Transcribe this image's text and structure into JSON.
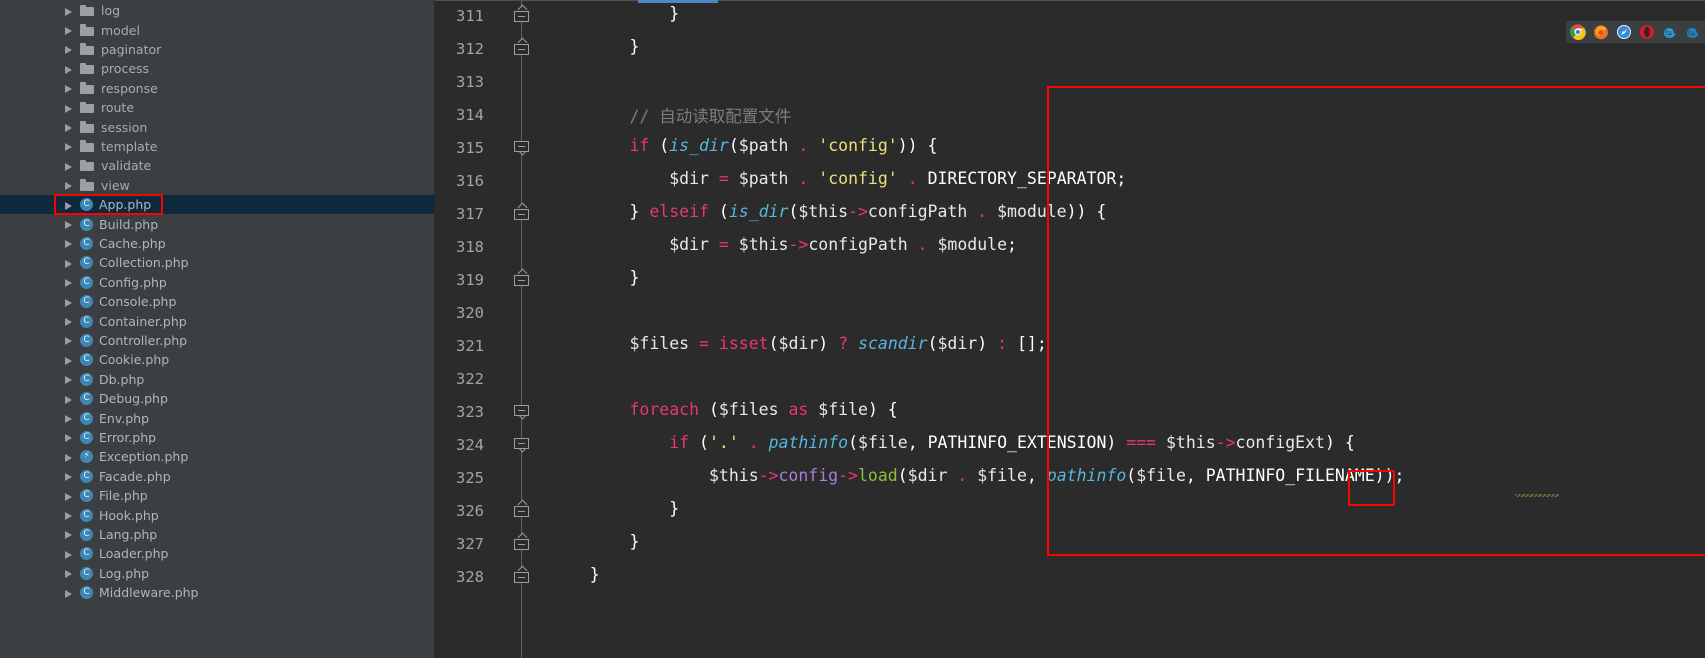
{
  "window": {
    "app": "PhpStorm IDE",
    "theme_bg": "#2b2b2b",
    "sidebar_bg": "#3c3f41",
    "accent": "#4a88c7",
    "highlight_color": "#ff0000"
  },
  "project_tree": {
    "name": "project-file-tree",
    "selected": "App.php",
    "items": [
      {
        "label": "log",
        "type": "folder"
      },
      {
        "label": "model",
        "type": "folder"
      },
      {
        "label": "paginator",
        "type": "folder"
      },
      {
        "label": "process",
        "type": "folder"
      },
      {
        "label": "response",
        "type": "folder"
      },
      {
        "label": "route",
        "type": "folder"
      },
      {
        "label": "session",
        "type": "folder"
      },
      {
        "label": "template",
        "type": "folder"
      },
      {
        "label": "validate",
        "type": "folder"
      },
      {
        "label": "view",
        "type": "folder"
      },
      {
        "label": "App.php",
        "type": "php-class",
        "icon_glyph": "C",
        "selected": true
      },
      {
        "label": "Build.php",
        "type": "php-class",
        "icon_glyph": "C"
      },
      {
        "label": "Cache.php",
        "type": "php-class",
        "icon_glyph": "C"
      },
      {
        "label": "Collection.php",
        "type": "php-class",
        "icon_glyph": "C"
      },
      {
        "label": "Config.php",
        "type": "php-class",
        "icon_glyph": "C"
      },
      {
        "label": "Console.php",
        "type": "php-class",
        "icon_glyph": "C"
      },
      {
        "label": "Container.php",
        "type": "php-class",
        "icon_glyph": "C"
      },
      {
        "label": "Controller.php",
        "type": "php-class",
        "icon_glyph": "C"
      },
      {
        "label": "Cookie.php",
        "type": "php-class",
        "icon_glyph": "C"
      },
      {
        "label": "Db.php",
        "type": "php-class",
        "icon_glyph": "C"
      },
      {
        "label": "Debug.php",
        "type": "php-class",
        "icon_glyph": "C"
      },
      {
        "label": "Env.php",
        "type": "php-class",
        "icon_glyph": "C"
      },
      {
        "label": "Error.php",
        "type": "php-class",
        "icon_glyph": "C"
      },
      {
        "label": "Exception.php",
        "type": "php-exception",
        "icon_glyph": "⚡"
      },
      {
        "label": "Facade.php",
        "type": "php-class",
        "icon_glyph": "C"
      },
      {
        "label": "File.php",
        "type": "php-class",
        "icon_glyph": "C"
      },
      {
        "label": "Hook.php",
        "type": "php-class",
        "icon_glyph": "C"
      },
      {
        "label": "Lang.php",
        "type": "php-class",
        "icon_glyph": "C"
      },
      {
        "label": "Loader.php",
        "type": "php-class",
        "icon_glyph": "C"
      },
      {
        "label": "Log.php",
        "type": "php-class",
        "icon_glyph": "C"
      },
      {
        "label": "Middleware.php",
        "type": "php-class",
        "icon_glyph": "C"
      }
    ]
  },
  "editor": {
    "name": "code-editor",
    "language": "PHP",
    "first_visible_line": 311,
    "line_numbers": [
      311,
      312,
      313,
      314,
      315,
      316,
      317,
      318,
      319,
      320,
      321,
      322,
      323,
      324,
      325,
      326,
      327,
      328
    ],
    "fold_markers": [
      {
        "line": 311,
        "direction": "up"
      },
      {
        "line": 312,
        "direction": "up"
      },
      {
        "line": 315,
        "direction": "down"
      },
      {
        "line": 317,
        "direction": "up"
      },
      {
        "line": 319,
        "direction": "up"
      },
      {
        "line": 323,
        "direction": "down"
      },
      {
        "line": 324,
        "direction": "down"
      },
      {
        "line": 326,
        "direction": "up"
      },
      {
        "line": 327,
        "direction": "up"
      },
      {
        "line": 328,
        "direction": "up"
      }
    ],
    "lines": [
      {
        "n": 311,
        "text": "            }"
      },
      {
        "n": 312,
        "text": "        }"
      },
      {
        "n": 313,
        "text": ""
      },
      {
        "n": 314,
        "text": "        // 自动读取配置文件"
      },
      {
        "n": 315,
        "text": "        if (is_dir($path . 'config')) {"
      },
      {
        "n": 316,
        "text": "            $dir = $path . 'config' . DIRECTORY_SEPARATOR;"
      },
      {
        "n": 317,
        "text": "        } elseif (is_dir($this->configPath . $module)) {"
      },
      {
        "n": 318,
        "text": "            $dir = $this->configPath . $module;"
      },
      {
        "n": 319,
        "text": "        }"
      },
      {
        "n": 320,
        "text": ""
      },
      {
        "n": 321,
        "text": "        $files = isset($dir) ? scandir($dir) : [];"
      },
      {
        "n": 322,
        "text": ""
      },
      {
        "n": 323,
        "text": "        foreach ($files as $file) {"
      },
      {
        "n": 324,
        "text": "            if ('.' . pathinfo($file, PATHINFO_EXTENSION) === $this->configExt) {"
      },
      {
        "n": 325,
        "text": "                $this->config->load($dir . $file, pathinfo($file, PATHINFO_FILENAME));"
      },
      {
        "n": 326,
        "text": "            }"
      },
      {
        "n": 327,
        "text": "        }"
      },
      {
        "n": 328,
        "text": "    }"
      }
    ],
    "comment_text": "// 自动读取配置文件",
    "annotations": {
      "block_outline": "red rectangle over lines 313-327",
      "load_call_outline": "red rectangle around the load method name"
    }
  },
  "browser_bar": {
    "name": "browser-preview-toolbar",
    "browsers": [
      {
        "name": "chrome-icon",
        "label": "Chrome"
      },
      {
        "name": "firefox-icon",
        "label": "Firefox"
      },
      {
        "name": "safari-icon",
        "label": "Safari"
      },
      {
        "name": "opera-icon",
        "label": "Opera"
      },
      {
        "name": "edge-icon",
        "label": "Edge"
      },
      {
        "name": "ie-icon",
        "label": "Internet Explorer"
      }
    ]
  }
}
